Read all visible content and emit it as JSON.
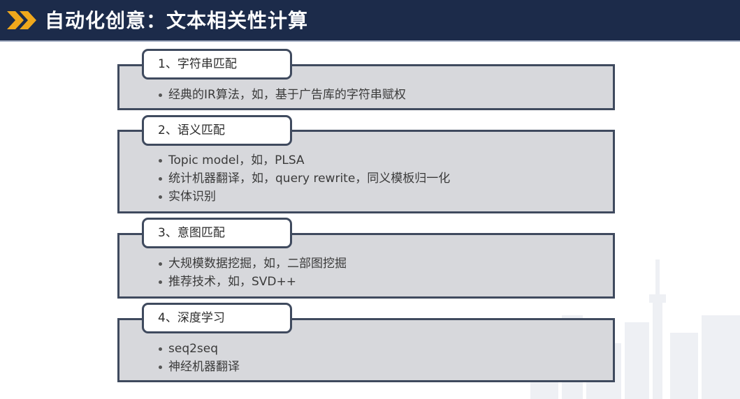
{
  "header": {
    "title": "自动化创意：文本相关性计算",
    "icon": "double-chevron-right-icon",
    "colors": {
      "bar": "#1c2b4a",
      "chevron": "#f0a81c",
      "title_text": "#ffffff"
    }
  },
  "sections": [
    {
      "label": "1、字符串匹配",
      "items": [
        "经典的IR算法，如，基于广告库的字符串赋权"
      ]
    },
    {
      "label": "2、语义匹配",
      "items": [
        "Topic model，如，PLSA",
        "统计机器翻译，如，query rewrite，同义模板归一化",
        "实体识别"
      ]
    },
    {
      "label": "3、意图匹配",
      "items": [
        "大规模数据挖掘，如，二部图挖掘",
        "推荐技术，如，SVD++"
      ]
    },
    {
      "label": "4、深度学习",
      "items": [
        "seq2seq",
        "神经机器翻译"
      ]
    }
  ],
  "colors": {
    "box_fill": "#d7d8dc",
    "box_border": "#3f4a5e",
    "tab_fill": "#ffffff"
  }
}
